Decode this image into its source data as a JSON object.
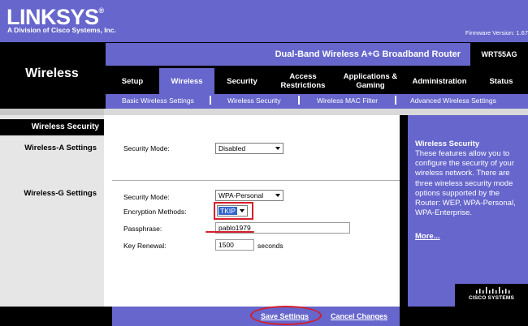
{
  "brand": {
    "logo": "LINKSYS",
    "logo_mark": "®",
    "tagline": "A Division of Cisco Systems, Inc."
  },
  "firmware": "Firmware Version: 1.67",
  "section_title": "Wireless",
  "product_name": "Dual-Band Wireless A+G Broadband Router",
  "model": "WRT55AG",
  "tabs": [
    {
      "label": "Setup",
      "active": false
    },
    {
      "label": "Wireless",
      "active": true
    },
    {
      "label": "Security",
      "active": false
    },
    {
      "label": "Access Restrictions",
      "active": false
    },
    {
      "label": "Applications & Gaming",
      "active": false
    },
    {
      "label": "Administration",
      "active": false
    },
    {
      "label": "Status",
      "active": false
    }
  ],
  "subtabs": [
    {
      "label": "Basic Wireless Settings"
    },
    {
      "label": "Wireless Security"
    },
    {
      "label": "Wireless MAC Filter"
    },
    {
      "label": "Advanced Wireless Settings"
    }
  ],
  "sidebar": {
    "header": "Wireless Security",
    "wireless_a": "Wireless-A Settings",
    "wireless_g": "Wireless-G Settings"
  },
  "form_a": {
    "security_mode_label": "Security Mode:",
    "security_mode_value": "Disabled"
  },
  "form_g": {
    "security_mode_label": "Security Mode:",
    "security_mode_value": "WPA-Personal",
    "encryption_label": "Encryption Methods:",
    "encryption_value": "TKIP",
    "passphrase_label": "Passphrase:",
    "passphrase_value": "pablo1979",
    "key_renewal_label": "Key Renewal:",
    "key_renewal_value": "1500",
    "key_renewal_unit": "seconds"
  },
  "help": {
    "title": "Wireless Security",
    "text": "These features allow you to configure the security of your wireless network. There are three wireless security mode options supported by the Router: WEP, WPA-Personal, WPA-Enterprise.",
    "more": "More..."
  },
  "cisco": {
    "text": "CISCO SYSTEMS"
  },
  "buttons": {
    "save": "Save Settings",
    "cancel": "Cancel Changes"
  },
  "colors": {
    "brand_purple": "#6666cc",
    "highlight_red": "#d4202a",
    "selection_blue": "#3366cc"
  }
}
